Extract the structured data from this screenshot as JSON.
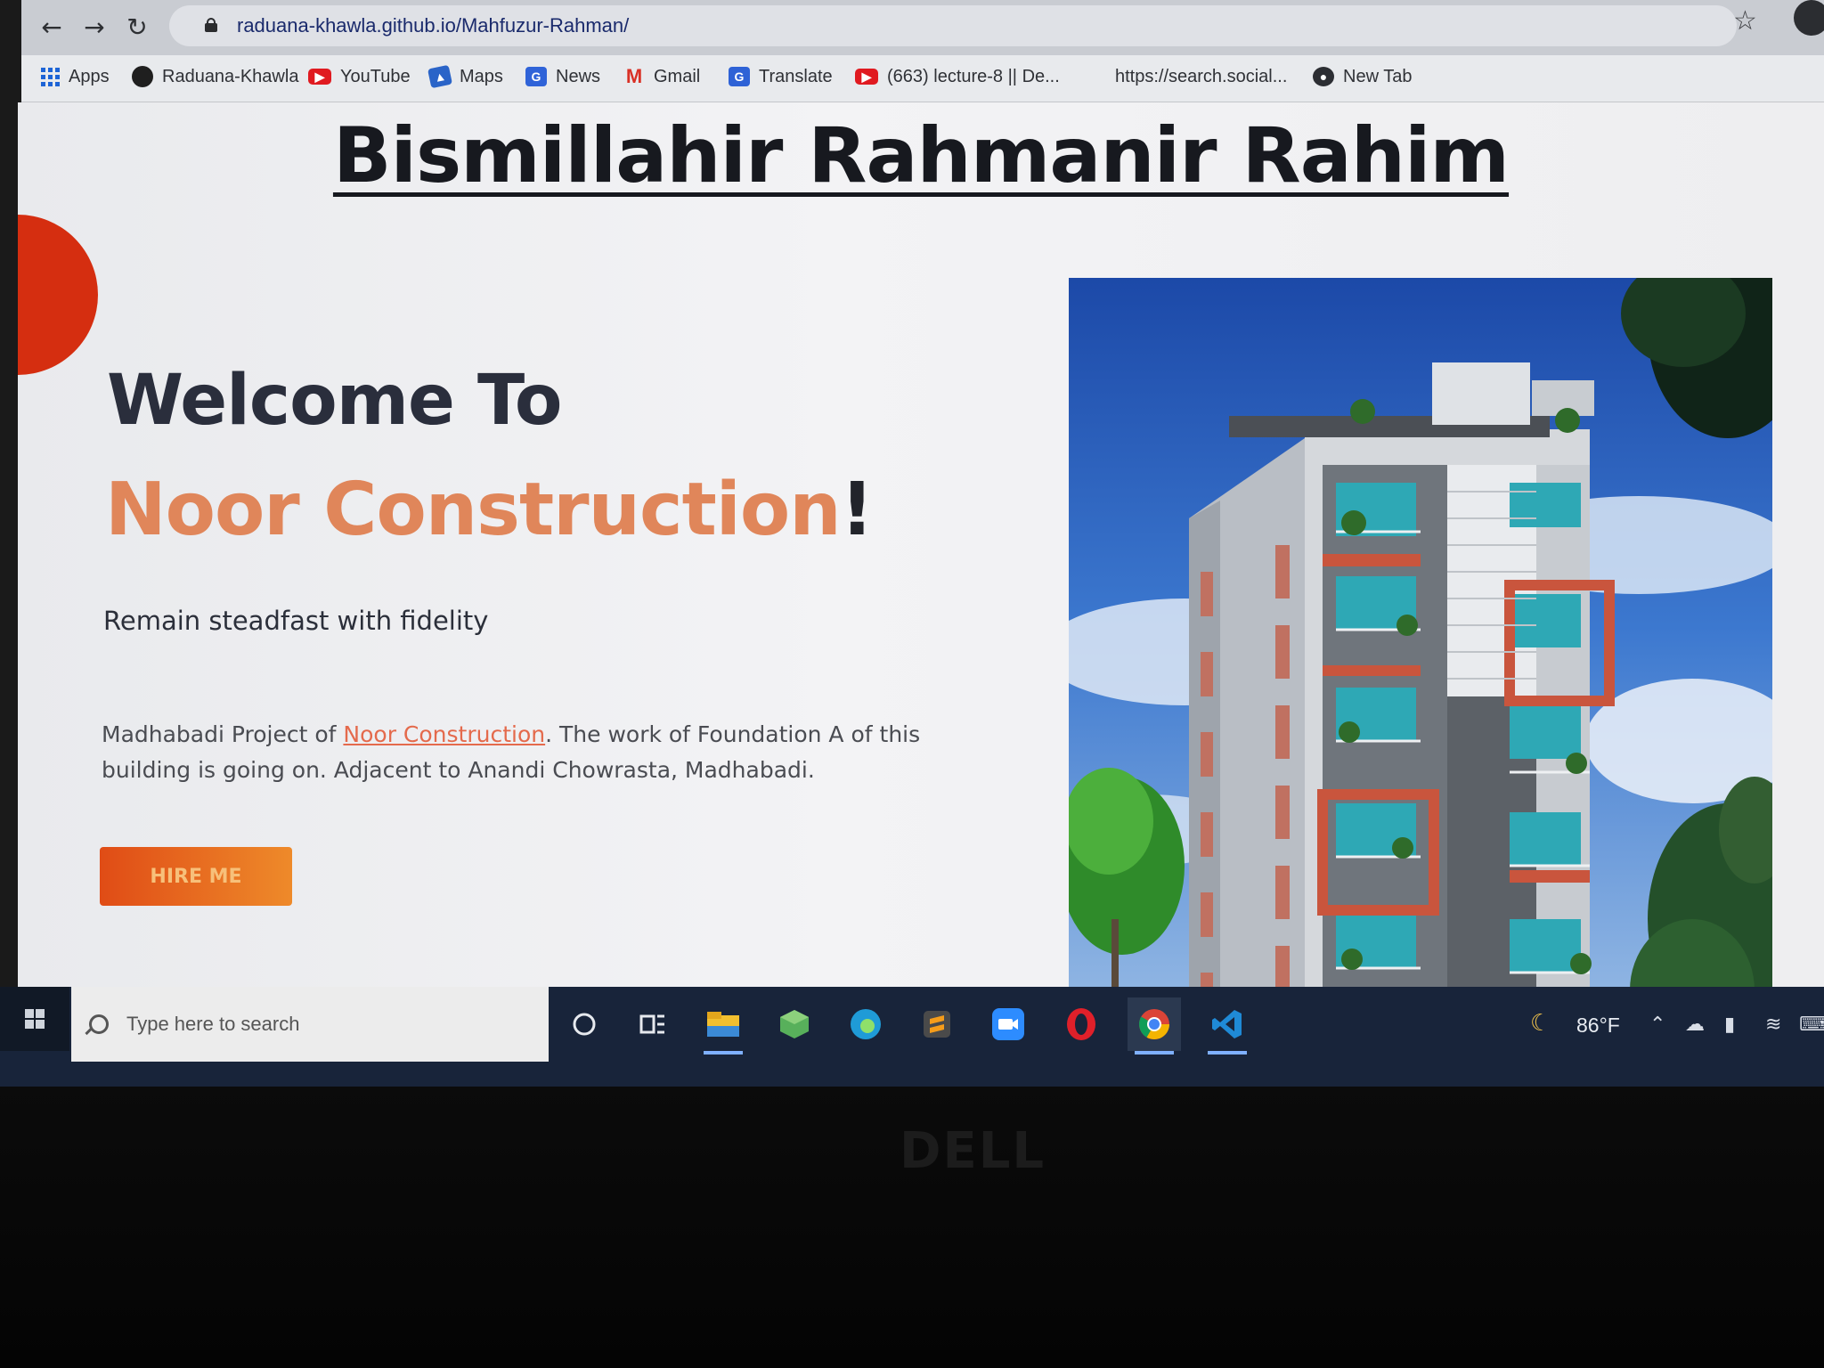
{
  "browser": {
    "url": "raduana-khawla.github.io/Mahfuzur-Rahman/",
    "bookmarks": [
      {
        "label": "Apps",
        "icon": "apps-grid-icon"
      },
      {
        "label": "Raduana-Khawla",
        "icon": "github-icon"
      },
      {
        "label": "YouTube",
        "icon": "youtube-icon"
      },
      {
        "label": "Maps",
        "icon": "maps-icon"
      },
      {
        "label": "News",
        "icon": "news-icon"
      },
      {
        "label": "Gmail",
        "icon": "gmail-icon"
      },
      {
        "label": "Translate",
        "icon": "translate-icon"
      },
      {
        "label": "(663) lecture-8 || De...",
        "icon": "youtube-icon"
      },
      {
        "label": "https://search.social...",
        "icon": ""
      },
      {
        "label": "New Tab",
        "icon": "globe-icon"
      }
    ]
  },
  "page": {
    "heading": "Bismillahir Rahmanir Rahim",
    "welcome": "Welcome To",
    "brand": "Noor Construction",
    "brand_suffix": "!",
    "tagline": "Remain steadfast with fidelity",
    "description_prefix": "Madhabadi Project of ",
    "description_link": "Noor Construction",
    "description_suffix": ". The work of Foundation A of this building is going on. Adjacent to Anandi Chowrasta, Madhabadi.",
    "cta_label": "HIRE ME",
    "colors": {
      "accent": "#e0865a",
      "button": "#e04c16",
      "corner": "#d52e10"
    }
  },
  "taskbar": {
    "search_placeholder": "Type here to search",
    "temperature": "86°F",
    "apps": [
      "cortana-circle-icon",
      "task-view-icon",
      "file-explorer-icon",
      "app-cube-icon",
      "edge-icon",
      "sublime-icon",
      "zoom-icon",
      "opera-icon",
      "chrome-icon",
      "vscode-icon"
    ]
  },
  "device": {
    "brand": "DELL"
  }
}
